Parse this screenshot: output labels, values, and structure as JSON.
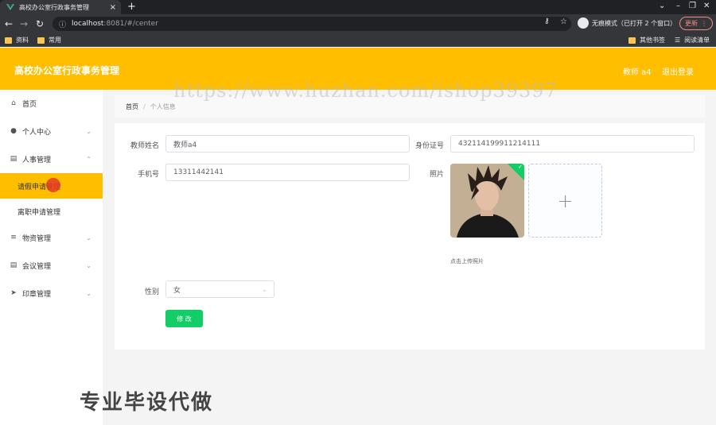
{
  "browser": {
    "tab_title": "高校办公室行政事务管理",
    "tab_close": "×",
    "new_tab": "+",
    "url_host": "localhost",
    "url_path": ":8081/#/center",
    "incognito_label": "无痕模式（已打开 2 个窗口）",
    "update_label": "更新",
    "bookmarks": [
      "资料",
      "常用"
    ],
    "other_bookmarks": "其他书签",
    "reading_list": "阅读清单"
  },
  "header": {
    "title": "高校办公室行政事务管理",
    "user": "教师 a4",
    "logout": "退出登录"
  },
  "sidebar": {
    "items": [
      {
        "label": "首页",
        "icon": "home-icon"
      },
      {
        "label": "个人中心",
        "icon": "user-icon"
      },
      {
        "label": "人事管理",
        "icon": "clipboard-icon"
      },
      {
        "label": "物资管理",
        "icon": "menu-icon"
      },
      {
        "label": "会议管理",
        "icon": "clipboard-icon"
      },
      {
        "label": "印章管理",
        "icon": "send-icon"
      }
    ],
    "subitems": [
      {
        "label": "请假申请管理",
        "active": true
      },
      {
        "label": "离职申请管理",
        "active": false
      }
    ]
  },
  "breadcrumb": {
    "home": "首页",
    "separator": "/",
    "current": "个人信息"
  },
  "form": {
    "name_label": "教师姓名",
    "name_value": "教师a4",
    "idcard_label": "身份证号",
    "idcard_value": "432114199911214111",
    "phone_label": "手机号",
    "phone_value": "13311442141",
    "photo_label": "照片",
    "upload_tip": "点击上传照片",
    "upload_plus": "+",
    "gender_label": "性别",
    "gender_value": "女",
    "submit_label": "修 改"
  },
  "overlay": {
    "watermark": "https://www.huzhan.com/ishop39397",
    "promo": "专业毕设代做"
  },
  "colors": {
    "header": "#ffbe00",
    "active_menu": "#ffbe00",
    "button": "#13ce66"
  }
}
